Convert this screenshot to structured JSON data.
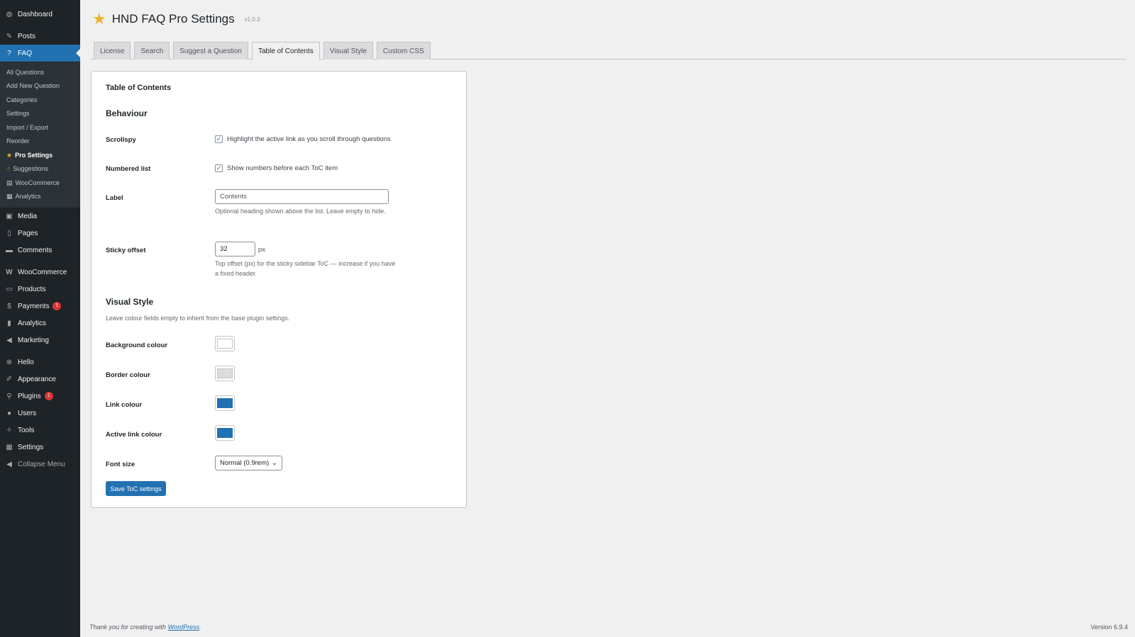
{
  "sidebar": {
    "top_items": [
      {
        "label": "Dashboard",
        "icon": "dashboard-icon",
        "glyph": "◍"
      },
      {
        "label": "Posts",
        "icon": "pin-icon",
        "glyph": "✎"
      },
      {
        "label": "FAQ",
        "icon": "question-icon",
        "glyph": "?"
      }
    ],
    "sub_items": [
      {
        "label": "All Questions"
      },
      {
        "label": "Add New Question"
      },
      {
        "label": "Categories"
      },
      {
        "label": "Settings"
      },
      {
        "label": "Import / Export"
      },
      {
        "label": "Reorder"
      },
      {
        "label": "Pro Settings",
        "glyph": "★"
      },
      {
        "label": "Suggestions",
        "glyph": "☝"
      },
      {
        "label": "WooCommerce",
        "glyph": "▤"
      },
      {
        "label": "Analytics",
        "glyph": "▦"
      }
    ],
    "bottom_items": [
      {
        "label": "Media",
        "icon": "media-icon",
        "glyph": "▣"
      },
      {
        "label": "Pages",
        "icon": "pages-icon",
        "glyph": "▯"
      },
      {
        "label": "Comments",
        "icon": "comment-icon",
        "glyph": "▬"
      },
      {
        "label": "WooCommerce",
        "icon": "woocommerce-icon",
        "glyph": "W"
      },
      {
        "label": "Products",
        "icon": "products-icon",
        "glyph": "▭"
      },
      {
        "label": "Payments",
        "icon": "payments-icon",
        "glyph": "$",
        "badge": "1"
      },
      {
        "label": "Analytics",
        "icon": "bar-chart-icon",
        "glyph": "▮"
      },
      {
        "label": "Marketing",
        "icon": "megaphone-icon",
        "glyph": "◀"
      },
      {
        "label": "Hello",
        "icon": "plus-circle-icon",
        "glyph": "⊕"
      },
      {
        "label": "Appearance",
        "icon": "brush-icon",
        "glyph": "✐"
      },
      {
        "label": "Plugins",
        "icon": "plug-icon",
        "glyph": "⚲",
        "badge": "1"
      },
      {
        "label": "Users",
        "icon": "user-icon",
        "glyph": "●"
      },
      {
        "label": "Tools",
        "icon": "wrench-icon",
        "glyph": "✧"
      },
      {
        "label": "Settings",
        "icon": "settings-icon",
        "glyph": "▦"
      },
      {
        "label": "Collapse Menu",
        "icon": "collapse-icon",
        "glyph": "◀"
      }
    ]
  },
  "header": {
    "title": "HND FAQ Pro Settings",
    "version": "v1.0.3",
    "star_glyph": "★"
  },
  "tabs": [
    "License",
    "Search",
    "Suggest a Question",
    "Table of Contents",
    "Visual Style",
    "Custom CSS"
  ],
  "active_tab": "Table of Contents",
  "panel": {
    "heading": "Table of Contents",
    "behaviour_heading": "Behaviour",
    "scrollspy": {
      "label": "Scrollspy",
      "checkbox_text": "Highlight the active link as you scroll through questions",
      "checked": true
    },
    "numbered": {
      "label": "Numbered list",
      "checkbox_text": "Show numbers before each ToC item",
      "checked": true
    },
    "label_field": {
      "label": "Label",
      "value": "Contents",
      "desc": "Optional heading shown above the list. Leave empty to hide."
    },
    "sticky": {
      "label": "Sticky offset",
      "value": "32",
      "unit": "px",
      "desc": "Top offset (px) for the sticky sidebar ToC — increase if you have a fixed header."
    },
    "visual_heading": "Visual Style",
    "visual_desc": "Leave colour fields empty to inherit from the base plugin settings.",
    "colours": [
      {
        "label": "Background colour",
        "color": "#ffffff"
      },
      {
        "label": "Border colour",
        "color": "#dcdcde"
      },
      {
        "label": "Link colour",
        "color": "#2271b1"
      },
      {
        "label": "Active link colour",
        "color": "#2271b1"
      }
    ],
    "font_size": {
      "label": "Font size",
      "value": "Normal (0.9rem)"
    },
    "save_label": "Save ToC settings"
  },
  "footer": {
    "thanks_prefix": "Thank you for creating with ",
    "thanks_link": "WordPress",
    "thanks_suffix": ".",
    "version": "Version 6.9.4"
  },
  "check_glyph": "✓",
  "chevron_glyph": "⌄"
}
